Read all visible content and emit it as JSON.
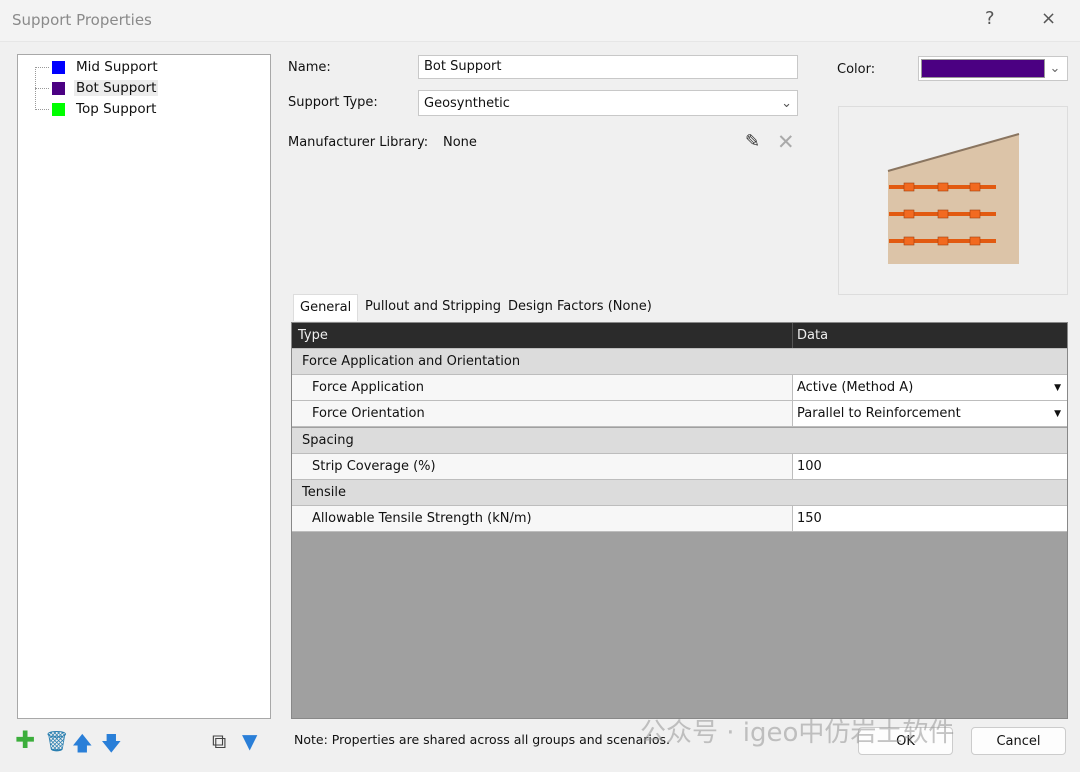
{
  "window": {
    "title": "Support Properties",
    "help": "?",
    "close": "×"
  },
  "tree": {
    "items": [
      {
        "label": "Mid Support",
        "color": "#0000ff"
      },
      {
        "label": "Bot Support",
        "color": "#4b0082",
        "selected": true
      },
      {
        "label": "Top Support",
        "color": "#00ff00"
      }
    ]
  },
  "form": {
    "name_label": "Name:",
    "name_value": "Bot Support",
    "type_label": "Support Type:",
    "type_value": "Geosynthetic",
    "library_label": "Manufacturer Library:",
    "library_value": "None",
    "color_label": "Color:",
    "color_value": "#4b0082"
  },
  "tabs": [
    {
      "label": "General",
      "active": true
    },
    {
      "label": "Pullout and Stripping"
    },
    {
      "label": "Design Factors (None)"
    }
  ],
  "grid": {
    "headers": [
      "Type",
      "Data"
    ],
    "groups": [
      {
        "title": "Force Application and Orientation",
        "rows": [
          {
            "name": "Force Application",
            "value": "Active (Method A)",
            "dropdown": true
          },
          {
            "name": "Force Orientation",
            "value": "Parallel to Reinforcement",
            "dropdown": true
          }
        ]
      },
      {
        "title": "Spacing",
        "rows": [
          {
            "name": "Strip Coverage (%)",
            "value": "100"
          }
        ]
      },
      {
        "title": "Tensile",
        "rows": [
          {
            "name": "Allowable Tensile Strength (kN/m)",
            "value": "150"
          }
        ]
      }
    ]
  },
  "footer": {
    "note": "Note: Properties are shared across all groups and scenarios.",
    "ok": "OK",
    "cancel": "Cancel"
  },
  "watermark": "公众号 · igeo中仿岩土软件"
}
